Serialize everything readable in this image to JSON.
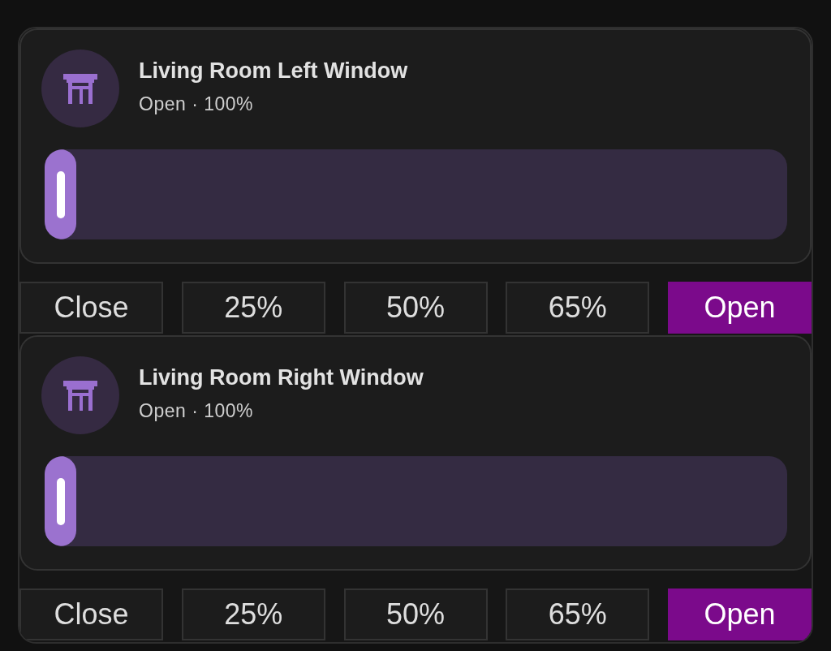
{
  "covers": [
    {
      "title": "Living Room Left Window",
      "status": "Open · 100%",
      "buttons": [
        {
          "label": "Close",
          "selected": false
        },
        {
          "label": "25%",
          "selected": false
        },
        {
          "label": "50%",
          "selected": false
        },
        {
          "label": "65%",
          "selected": false
        },
        {
          "label": "Open",
          "selected": true
        }
      ]
    },
    {
      "title": "Living Room Right Window",
      "status": "Open · 100%",
      "buttons": [
        {
          "label": "Close",
          "selected": false
        },
        {
          "label": "25%",
          "selected": false
        },
        {
          "label": "50%",
          "selected": false
        },
        {
          "label": "65%",
          "selected": false
        },
        {
          "label": "Open",
          "selected": true
        }
      ]
    }
  ]
}
